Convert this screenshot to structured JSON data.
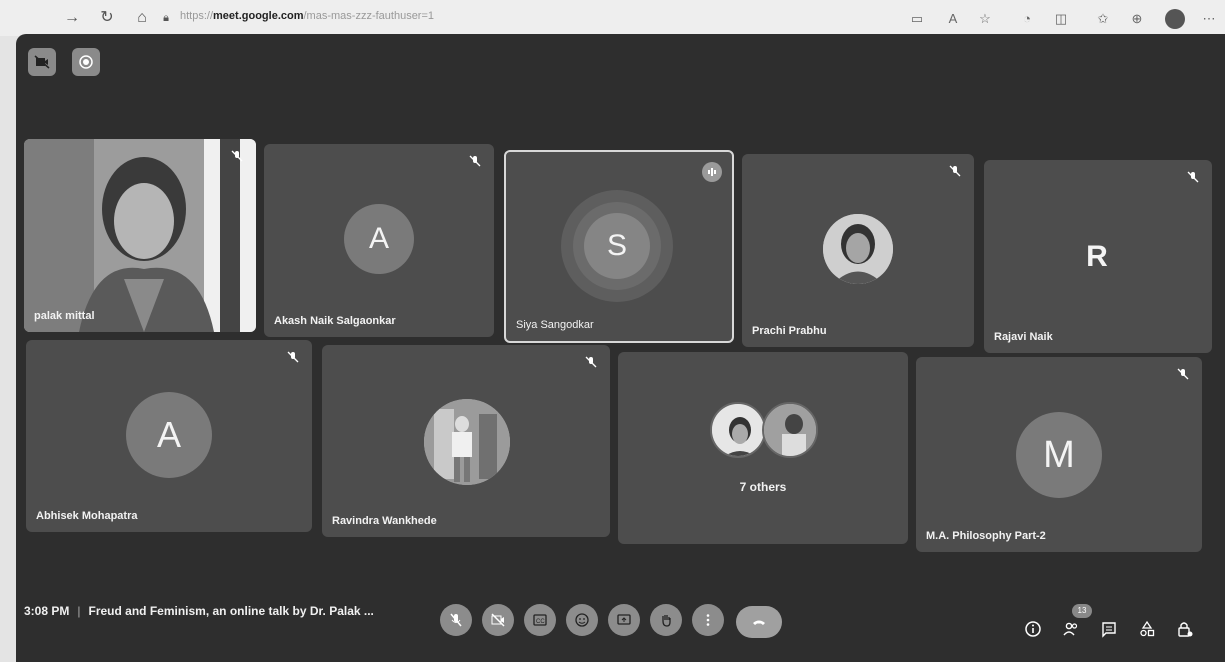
{
  "browser": {
    "url_scheme": "https://",
    "url_host": "meet.google.com",
    "url_path": "/mas-mas-zzz-fauthuser=1"
  },
  "meeting": {
    "time": "3:08 PM",
    "title": "Freud and Feminism, an online talk by Dr. Palak ...",
    "participant_count": "13"
  },
  "participants": [
    {
      "name": "palak mittal",
      "type": "video"
    },
    {
      "name": "Akash Naik Salgaonkar",
      "initial": "A"
    },
    {
      "name": "Siya Sangodkar",
      "initial": "S",
      "speaking": true
    },
    {
      "name": "Prachi Prabhu",
      "type": "photo"
    },
    {
      "name": "Rajavi Naik",
      "initial": "R"
    },
    {
      "name": "Abhisek Mohapatra",
      "initial": "A"
    },
    {
      "name": "Ravindra Wankhede",
      "type": "photo"
    },
    {
      "name": "7 others",
      "type": "group"
    },
    {
      "name": "M.A. Philosophy Part-2",
      "initial": "M"
    }
  ],
  "controls": [
    "mic-off",
    "camera-off",
    "captions",
    "emoji",
    "present",
    "raise-hand",
    "more",
    "hang-up"
  ],
  "right_controls": [
    "info",
    "people",
    "chat",
    "activities",
    "host-controls"
  ]
}
